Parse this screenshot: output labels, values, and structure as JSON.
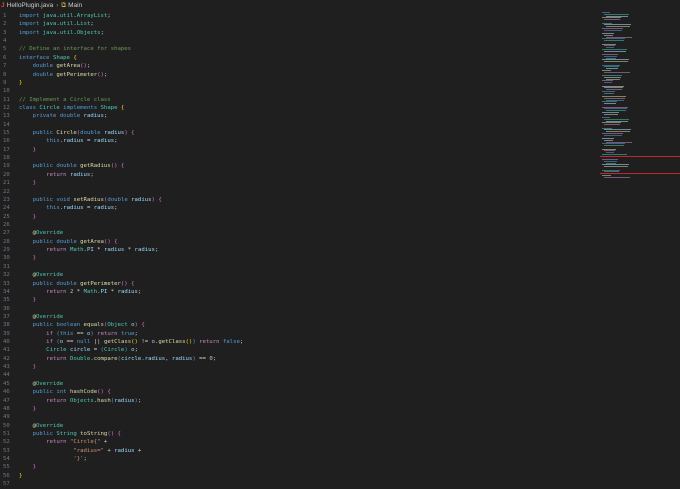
{
  "tab": {
    "file": "HelloPlugin.java",
    "breadcrumb": "Main"
  },
  "lines": [
    [
      [
        "k",
        "import "
      ],
      [
        "t",
        "java"
      ],
      [
        "p",
        "."
      ],
      [
        "t",
        "util"
      ],
      [
        "p",
        "."
      ],
      [
        "t",
        "ArrayList"
      ],
      [
        "p",
        ";"
      ]
    ],
    [
      [
        "k",
        "import "
      ],
      [
        "t",
        "java"
      ],
      [
        "p",
        "."
      ],
      [
        "t",
        "util"
      ],
      [
        "p",
        "."
      ],
      [
        "t",
        "List"
      ],
      [
        "p",
        ";"
      ]
    ],
    [
      [
        "k",
        "import "
      ],
      [
        "t",
        "java"
      ],
      [
        "p",
        "."
      ],
      [
        "t",
        "util"
      ],
      [
        "p",
        "."
      ],
      [
        "t",
        "Objects"
      ],
      [
        "p",
        ";"
      ]
    ],
    [],
    [
      [
        "m",
        "// Define an interface for shapes"
      ]
    ],
    [
      [
        "k",
        "interface "
      ],
      [
        "t",
        "Shape "
      ],
      [
        "b",
        "{"
      ]
    ],
    [
      [
        "p",
        "    "
      ],
      [
        "k",
        "double "
      ],
      [
        "f",
        "getArea"
      ],
      [
        "q",
        "()"
      ],
      [
        "p",
        ";"
      ]
    ],
    [
      [
        "p",
        "    "
      ],
      [
        "k",
        "double "
      ],
      [
        "f",
        "getPerimeter"
      ],
      [
        "q",
        "()"
      ],
      [
        "p",
        ";"
      ]
    ],
    [
      [
        "b",
        "}"
      ]
    ],
    [],
    [
      [
        "m",
        "// Implement a Circle class"
      ]
    ],
    [
      [
        "k",
        "class "
      ],
      [
        "t",
        "Circle "
      ],
      [
        "k",
        "implements "
      ],
      [
        "t",
        "Shape "
      ],
      [
        "b",
        "{"
      ]
    ],
    [
      [
        "p",
        "    "
      ],
      [
        "k",
        "private double "
      ],
      [
        "v",
        "radius"
      ],
      [
        "p",
        ";"
      ]
    ],
    [],
    [
      [
        "p",
        "    "
      ],
      [
        "k",
        "public "
      ],
      [
        "f",
        "Circle"
      ],
      [
        "q",
        "("
      ],
      [
        "k",
        "double "
      ],
      [
        "v",
        "radius"
      ],
      [
        "q",
        ")"
      ],
      [
        "p",
        " "
      ],
      [
        "q",
        "{"
      ]
    ],
    [
      [
        "p",
        "        "
      ],
      [
        "k",
        "this"
      ],
      [
        "p",
        "."
      ],
      [
        "v",
        "radius"
      ],
      [
        "p",
        " = "
      ],
      [
        "v",
        "radius"
      ],
      [
        "p",
        ";"
      ]
    ],
    [
      [
        "p",
        "    "
      ],
      [
        "q",
        "}"
      ]
    ],
    [],
    [
      [
        "p",
        "    "
      ],
      [
        "k",
        "public double "
      ],
      [
        "f",
        "getRadius"
      ],
      [
        "q",
        "()"
      ],
      [
        "p",
        " "
      ],
      [
        "q",
        "{"
      ]
    ],
    [
      [
        "p",
        "        "
      ],
      [
        "c",
        "return "
      ],
      [
        "v",
        "radius"
      ],
      [
        "p",
        ";"
      ]
    ],
    [
      [
        "p",
        "    "
      ],
      [
        "q",
        "}"
      ]
    ],
    [],
    [
      [
        "p",
        "    "
      ],
      [
        "k",
        "public void "
      ],
      [
        "f",
        "setRadius"
      ],
      [
        "q",
        "("
      ],
      [
        "k",
        "double "
      ],
      [
        "v",
        "radius"
      ],
      [
        "q",
        ")"
      ],
      [
        "p",
        " "
      ],
      [
        "q",
        "{"
      ]
    ],
    [
      [
        "p",
        "        "
      ],
      [
        "k",
        "this"
      ],
      [
        "p",
        "."
      ],
      [
        "v",
        "radius"
      ],
      [
        "p",
        " = "
      ],
      [
        "v",
        "radius"
      ],
      [
        "p",
        ";"
      ]
    ],
    [
      [
        "p",
        "    "
      ],
      [
        "q",
        "}"
      ]
    ],
    [],
    [
      [
        "p",
        "    "
      ],
      [
        "a",
        "@"
      ],
      [
        "t",
        "Override"
      ]
    ],
    [
      [
        "p",
        "    "
      ],
      [
        "k",
        "public double "
      ],
      [
        "f",
        "getArea"
      ],
      [
        "q",
        "()"
      ],
      [
        "p",
        " "
      ],
      [
        "q",
        "{"
      ]
    ],
    [
      [
        "p",
        "        "
      ],
      [
        "c",
        "return "
      ],
      [
        "t",
        "Math"
      ],
      [
        "p",
        "."
      ],
      [
        "v",
        "PI"
      ],
      [
        "p",
        " * "
      ],
      [
        "v",
        "radius"
      ],
      [
        "p",
        " * "
      ],
      [
        "v",
        "radius"
      ],
      [
        "p",
        ";"
      ]
    ],
    [
      [
        "p",
        "    "
      ],
      [
        "q",
        "}"
      ]
    ],
    [],
    [
      [
        "p",
        "    "
      ],
      [
        "a",
        "@"
      ],
      [
        "t",
        "Override"
      ]
    ],
    [
      [
        "p",
        "    "
      ],
      [
        "k",
        "public double "
      ],
      [
        "f",
        "getPerimeter"
      ],
      [
        "q",
        "()"
      ],
      [
        "p",
        " "
      ],
      [
        "q",
        "{"
      ]
    ],
    [
      [
        "p",
        "        "
      ],
      [
        "c",
        "return "
      ],
      [
        "n",
        "2"
      ],
      [
        "p",
        " * "
      ],
      [
        "t",
        "Math"
      ],
      [
        "p",
        "."
      ],
      [
        "v",
        "PI"
      ],
      [
        "p",
        " * "
      ],
      [
        "v",
        "radius"
      ],
      [
        "p",
        ";"
      ]
    ],
    [
      [
        "p",
        "    "
      ],
      [
        "q",
        "}"
      ]
    ],
    [],
    [
      [
        "p",
        "    "
      ],
      [
        "a",
        "@"
      ],
      [
        "t",
        "Override"
      ]
    ],
    [
      [
        "p",
        "    "
      ],
      [
        "k",
        "public boolean "
      ],
      [
        "f",
        "equals"
      ],
      [
        "q",
        "("
      ],
      [
        "t",
        "Object "
      ],
      [
        "v",
        "o"
      ],
      [
        "q",
        ")"
      ],
      [
        "p",
        " "
      ],
      [
        "q",
        "{"
      ]
    ],
    [
      [
        "p",
        "        "
      ],
      [
        "c",
        "if "
      ],
      [
        "k",
        "("
      ],
      [
        "k",
        "this"
      ],
      [
        "p",
        " == "
      ],
      [
        "v",
        "o"
      ],
      [
        "k",
        ")"
      ],
      [
        "c",
        " return "
      ],
      [
        "k",
        "true"
      ],
      [
        "p",
        ";"
      ]
    ],
    [
      [
        "p",
        "        "
      ],
      [
        "c",
        "if "
      ],
      [
        "k",
        "("
      ],
      [
        "v",
        "o"
      ],
      [
        "p",
        " == "
      ],
      [
        "k",
        "null"
      ],
      [
        "p",
        " || "
      ],
      [
        "f",
        "getClass"
      ],
      [
        "b",
        "()"
      ],
      [
        "p",
        " != "
      ],
      [
        "v",
        "o"
      ],
      [
        "p",
        "."
      ],
      [
        "f",
        "getClass"
      ],
      [
        "b",
        "()"
      ],
      [
        "k",
        ")"
      ],
      [
        "c",
        " return "
      ],
      [
        "k",
        "false"
      ],
      [
        "p",
        ";"
      ]
    ],
    [
      [
        "p",
        "        "
      ],
      [
        "t",
        "Circle "
      ],
      [
        "v",
        "circle"
      ],
      [
        "p",
        " = "
      ],
      [
        "k",
        "("
      ],
      [
        "t",
        "Circle"
      ],
      [
        "k",
        ")"
      ],
      [
        "p",
        " "
      ],
      [
        "v",
        "o"
      ],
      [
        "p",
        ";"
      ]
    ],
    [
      [
        "p",
        "        "
      ],
      [
        "c",
        "return "
      ],
      [
        "t",
        "Double"
      ],
      [
        "p",
        "."
      ],
      [
        "f",
        "compare"
      ],
      [
        "k",
        "("
      ],
      [
        "v",
        "circle"
      ],
      [
        "p",
        "."
      ],
      [
        "v",
        "radius"
      ],
      [
        "p",
        ", "
      ],
      [
        "v",
        "radius"
      ],
      [
        "k",
        ")"
      ],
      [
        "p",
        " == "
      ],
      [
        "n",
        "0"
      ],
      [
        "p",
        ";"
      ]
    ],
    [
      [
        "p",
        "    "
      ],
      [
        "q",
        "}"
      ]
    ],
    [],
    [
      [
        "p",
        "    "
      ],
      [
        "a",
        "@"
      ],
      [
        "t",
        "Override"
      ]
    ],
    [
      [
        "p",
        "    "
      ],
      [
        "k",
        "public int "
      ],
      [
        "f",
        "hashCode"
      ],
      [
        "q",
        "()"
      ],
      [
        "p",
        " "
      ],
      [
        "q",
        "{"
      ]
    ],
    [
      [
        "p",
        "        "
      ],
      [
        "c",
        "return "
      ],
      [
        "t",
        "Objects"
      ],
      [
        "p",
        "."
      ],
      [
        "f",
        "hash"
      ],
      [
        "k",
        "("
      ],
      [
        "v",
        "radius"
      ],
      [
        "k",
        ")"
      ],
      [
        "p",
        ";"
      ]
    ],
    [
      [
        "p",
        "    "
      ],
      [
        "q",
        "}"
      ]
    ],
    [],
    [
      [
        "p",
        "    "
      ],
      [
        "a",
        "@"
      ],
      [
        "t",
        "Override"
      ]
    ],
    [
      [
        "p",
        "    "
      ],
      [
        "k",
        "public "
      ],
      [
        "t",
        "String "
      ],
      [
        "f",
        "toString"
      ],
      [
        "q",
        "()"
      ],
      [
        "p",
        " "
      ],
      [
        "q",
        "{"
      ]
    ],
    [
      [
        "p",
        "        "
      ],
      [
        "c",
        "return "
      ],
      [
        "s",
        "\"Circle{\""
      ],
      [
        "p",
        " +"
      ]
    ],
    [
      [
        "p",
        "                "
      ],
      [
        "s",
        "\"radius=\""
      ],
      [
        "p",
        " + "
      ],
      [
        "v",
        "radius"
      ],
      [
        "p",
        " +"
      ]
    ],
    [
      [
        "p",
        "                "
      ],
      [
        "s",
        "'}'"
      ],
      [
        "p",
        ";"
      ]
    ],
    [
      [
        "p",
        "    "
      ],
      [
        "q",
        "}"
      ]
    ],
    [
      [
        "b",
        "}"
      ]
    ],
    []
  ]
}
